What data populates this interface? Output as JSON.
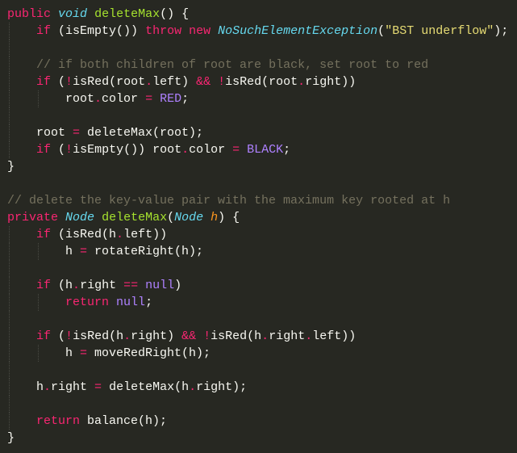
{
  "colors": {
    "background": "#272822",
    "keyword": "#f92672",
    "type": "#66d9ef",
    "function": "#a6e22e",
    "string": "#e6db74",
    "comment": "#75715e",
    "constant": "#ae81ff",
    "param": "#fd971f",
    "text": "#f8f8f2"
  },
  "lines": [
    [
      [
        "kw",
        "public"
      ],
      [
        "tx",
        " "
      ],
      [
        "type",
        "void"
      ],
      [
        "tx",
        " "
      ],
      [
        "fn",
        "deleteMax"
      ],
      [
        "tx",
        "() {"
      ]
    ],
    [
      [
        "tx",
        "    "
      ],
      [
        "kw",
        "if"
      ],
      [
        "tx",
        " (isEmpty()) "
      ],
      [
        "kw",
        "throw"
      ],
      [
        "tx",
        " "
      ],
      [
        "kw",
        "new"
      ],
      [
        "tx",
        " "
      ],
      [
        "type",
        "NoSuchElementException"
      ],
      [
        "tx",
        "("
      ],
      [
        "str",
        "\"BST underflow\""
      ],
      [
        "tx",
        ");"
      ]
    ],
    [],
    [
      [
        "tx",
        "    "
      ],
      [
        "cm",
        "// if both children of root are black, set root to red"
      ]
    ],
    [
      [
        "tx",
        "    "
      ],
      [
        "kw",
        "if"
      ],
      [
        "tx",
        " ("
      ],
      [
        "op",
        "!"
      ],
      [
        "tx",
        "isRed(root"
      ],
      [
        "op",
        "."
      ],
      [
        "tx",
        "left) "
      ],
      [
        "op",
        "&&"
      ],
      [
        "tx",
        " "
      ],
      [
        "op",
        "!"
      ],
      [
        "tx",
        "isRed(root"
      ],
      [
        "op",
        "."
      ],
      [
        "tx",
        "right))"
      ]
    ],
    [
      [
        "tx",
        "        root"
      ],
      [
        "op",
        "."
      ],
      [
        "tx",
        "color "
      ],
      [
        "op",
        "="
      ],
      [
        "tx",
        " "
      ],
      [
        "const",
        "RED"
      ],
      [
        "tx",
        ";"
      ]
    ],
    [],
    [
      [
        "tx",
        "    root "
      ],
      [
        "op",
        "="
      ],
      [
        "tx",
        " deleteMax(root);"
      ]
    ],
    [
      [
        "tx",
        "    "
      ],
      [
        "kw",
        "if"
      ],
      [
        "tx",
        " ("
      ],
      [
        "op",
        "!"
      ],
      [
        "tx",
        "isEmpty()) root"
      ],
      [
        "op",
        "."
      ],
      [
        "tx",
        "color "
      ],
      [
        "op",
        "="
      ],
      [
        "tx",
        " "
      ],
      [
        "const",
        "BLACK"
      ],
      [
        "tx",
        ";"
      ]
    ],
    [
      [
        "tx",
        "}"
      ]
    ],
    [],
    [
      [
        "cm",
        "// delete the key-value pair with the maximum key rooted at h"
      ]
    ],
    [
      [
        "kw",
        "private"
      ],
      [
        "tx",
        " "
      ],
      [
        "type",
        "Node"
      ],
      [
        "tx",
        " "
      ],
      [
        "fn",
        "deleteMax"
      ],
      [
        "tx",
        "("
      ],
      [
        "type",
        "Node"
      ],
      [
        "tx",
        " "
      ],
      [
        "param",
        "h"
      ],
      [
        "tx",
        ") {"
      ]
    ],
    [
      [
        "tx",
        "    "
      ],
      [
        "kw",
        "if"
      ],
      [
        "tx",
        " (isRed(h"
      ],
      [
        "op",
        "."
      ],
      [
        "tx",
        "left))"
      ]
    ],
    [
      [
        "tx",
        "        h "
      ],
      [
        "op",
        "="
      ],
      [
        "tx",
        " rotateRight(h);"
      ]
    ],
    [],
    [
      [
        "tx",
        "    "
      ],
      [
        "kw",
        "if"
      ],
      [
        "tx",
        " (h"
      ],
      [
        "op",
        "."
      ],
      [
        "tx",
        "right "
      ],
      [
        "op",
        "=="
      ],
      [
        "tx",
        " "
      ],
      [
        "const",
        "null"
      ],
      [
        "tx",
        ")"
      ]
    ],
    [
      [
        "tx",
        "        "
      ],
      [
        "kw",
        "return"
      ],
      [
        "tx",
        " "
      ],
      [
        "const",
        "null"
      ],
      [
        "tx",
        ";"
      ]
    ],
    [],
    [
      [
        "tx",
        "    "
      ],
      [
        "kw",
        "if"
      ],
      [
        "tx",
        " ("
      ],
      [
        "op",
        "!"
      ],
      [
        "tx",
        "isRed(h"
      ],
      [
        "op",
        "."
      ],
      [
        "tx",
        "right) "
      ],
      [
        "op",
        "&&"
      ],
      [
        "tx",
        " "
      ],
      [
        "op",
        "!"
      ],
      [
        "tx",
        "isRed(h"
      ],
      [
        "op",
        "."
      ],
      [
        "tx",
        "right"
      ],
      [
        "op",
        "."
      ],
      [
        "tx",
        "left))"
      ]
    ],
    [
      [
        "tx",
        "        h "
      ],
      [
        "op",
        "="
      ],
      [
        "tx",
        " moveRedRight(h);"
      ]
    ],
    [],
    [
      [
        "tx",
        "    h"
      ],
      [
        "op",
        "."
      ],
      [
        "tx",
        "right "
      ],
      [
        "op",
        "="
      ],
      [
        "tx",
        " deleteMax(h"
      ],
      [
        "op",
        "."
      ],
      [
        "tx",
        "right);"
      ]
    ],
    [],
    [
      [
        "tx",
        "    "
      ],
      [
        "kw",
        "return"
      ],
      [
        "tx",
        " balance(h);"
      ]
    ],
    [
      [
        "tx",
        "}"
      ]
    ]
  ]
}
